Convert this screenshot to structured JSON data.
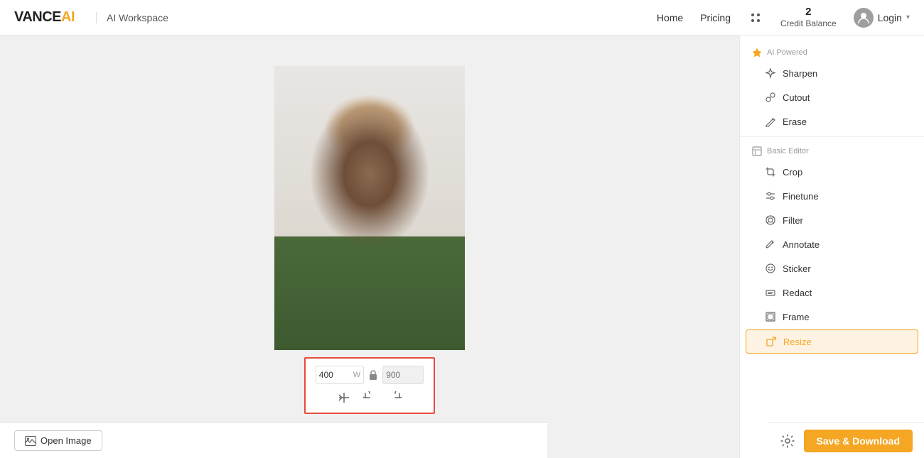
{
  "header": {
    "logo_vance": "VANCE",
    "logo_ai": "AI",
    "workspace_label": "AI Workspace",
    "nav": {
      "home_label": "Home",
      "pricing_label": "Pricing",
      "login_label": "Login"
    },
    "credit_balance": {
      "number": "2",
      "label": "Credit Balance"
    }
  },
  "sidebar": {
    "section_ai_powered": "AI Powered",
    "items": [
      {
        "id": "sharpen",
        "label": "Sharpen",
        "icon": "sharpen"
      },
      {
        "id": "cutout",
        "label": "Cutout",
        "icon": "cutout"
      },
      {
        "id": "erase",
        "label": "Erase",
        "icon": "erase"
      }
    ],
    "section_basic_editor": "Basic Editor",
    "basic_items": [
      {
        "id": "crop",
        "label": "Crop",
        "icon": "crop"
      },
      {
        "id": "finetune",
        "label": "Finetune",
        "icon": "finetune"
      },
      {
        "id": "filter",
        "label": "Filter",
        "icon": "filter"
      },
      {
        "id": "annotate",
        "label": "Annotate",
        "icon": "annotate"
      },
      {
        "id": "sticker",
        "label": "Sticker",
        "icon": "sticker"
      },
      {
        "id": "redact",
        "label": "Redact",
        "icon": "redact"
      },
      {
        "id": "frame",
        "label": "Frame",
        "icon": "frame"
      },
      {
        "id": "resize",
        "label": "Resize",
        "icon": "resize",
        "active": true
      }
    ]
  },
  "resize_controls": {
    "width_value": "400",
    "width_suffix": "W",
    "height_placeholder": "900",
    "height_suffix": ""
  },
  "bottom_bar": {
    "open_image_label": "Open Image"
  },
  "save_btn_label": "Save & Download"
}
